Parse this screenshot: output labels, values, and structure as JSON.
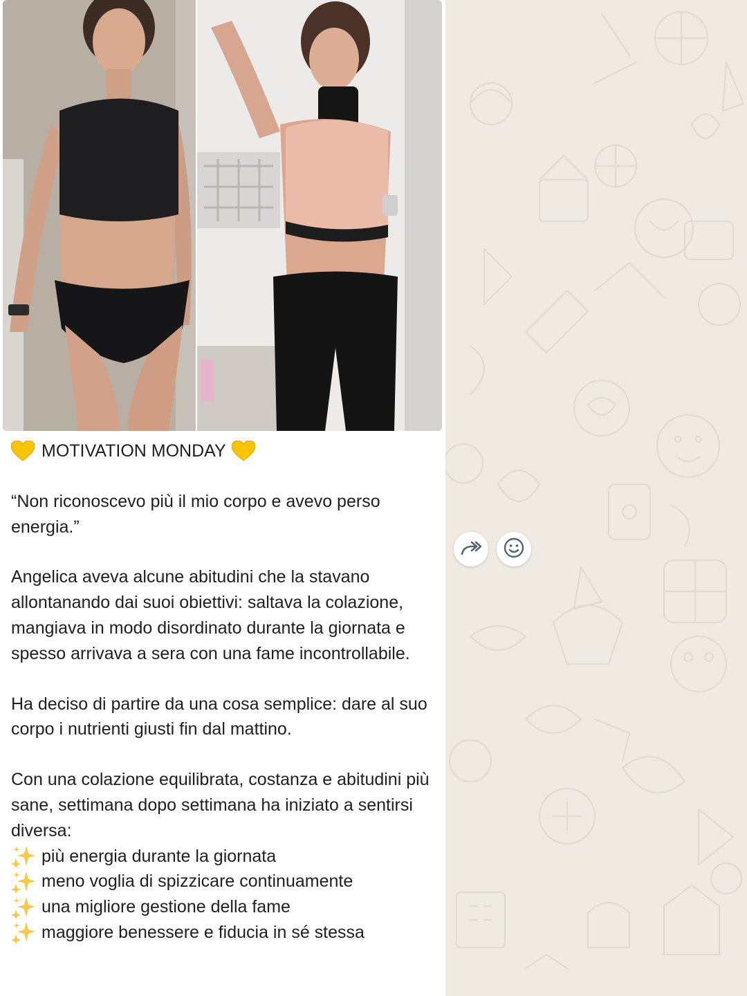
{
  "message": {
    "media": {
      "photos": [
        {
          "name": "before-photo"
        },
        {
          "name": "after-photo"
        }
      ]
    },
    "title": {
      "emoji_left": "💛",
      "text": "MOTIVATION MONDAY",
      "emoji_right": "💛"
    },
    "quote": "“Non riconoscevo più il mio corpo e avevo perso energia.”",
    "paragraph_1": "Angelica aveva alcune abitudini che la stavano allontanando dai suoi obiettivi: saltava la colazione, mangiava in modo disordinato durante la giornata e spesso arrivava a sera con una fame incontrollabile.",
    "paragraph_2": "Ha deciso di partire da una cosa semplice: dare al suo corpo i nutrienti giusti fin dal mattino.",
    "paragraph_3": "Con una colazione equilibrata, costanza e abitudini più sane, settimana dopo settimana ha iniziato a sentirsi diversa:",
    "bullets": [
      {
        "emoji": "✨",
        "text": "più energia durante la giornata"
      },
      {
        "emoji": "✨",
        "text": "meno voglia di spizzicare continuamente"
      },
      {
        "emoji": "✨",
        "text": "una migliore gestione della fame"
      },
      {
        "emoji": "✨",
        "text": "maggiore benessere e fiducia in sé stessa"
      }
    ]
  },
  "actions": {
    "forward_icon": "forward-icon",
    "emoji_icon": "emoji-reaction-icon"
  },
  "colors": {
    "wallpaper": "#efeae2",
    "bubble": "#ffffff",
    "text": "#1f1f1f",
    "icon": "#54656f"
  }
}
